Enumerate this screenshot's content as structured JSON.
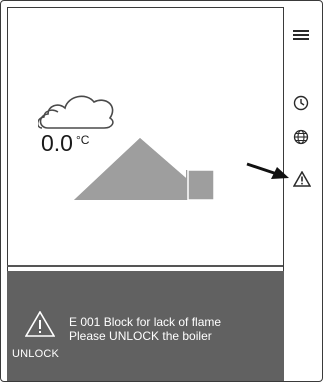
{
  "weather": {
    "temperature": "0.0",
    "unit": "°C"
  },
  "sidebar": {
    "icons": [
      "menu-icon",
      "clock-icon",
      "globe-icon",
      "warning-icon"
    ]
  },
  "alarm": {
    "line1": "E 001 Block for lack of flame",
    "line2": "Please UNLOCK the boiler",
    "unlock_label": "UNLOCK"
  },
  "colors": {
    "panel": "#616161",
    "house": "#9e9e9e",
    "outline": "#3a3a3a"
  }
}
